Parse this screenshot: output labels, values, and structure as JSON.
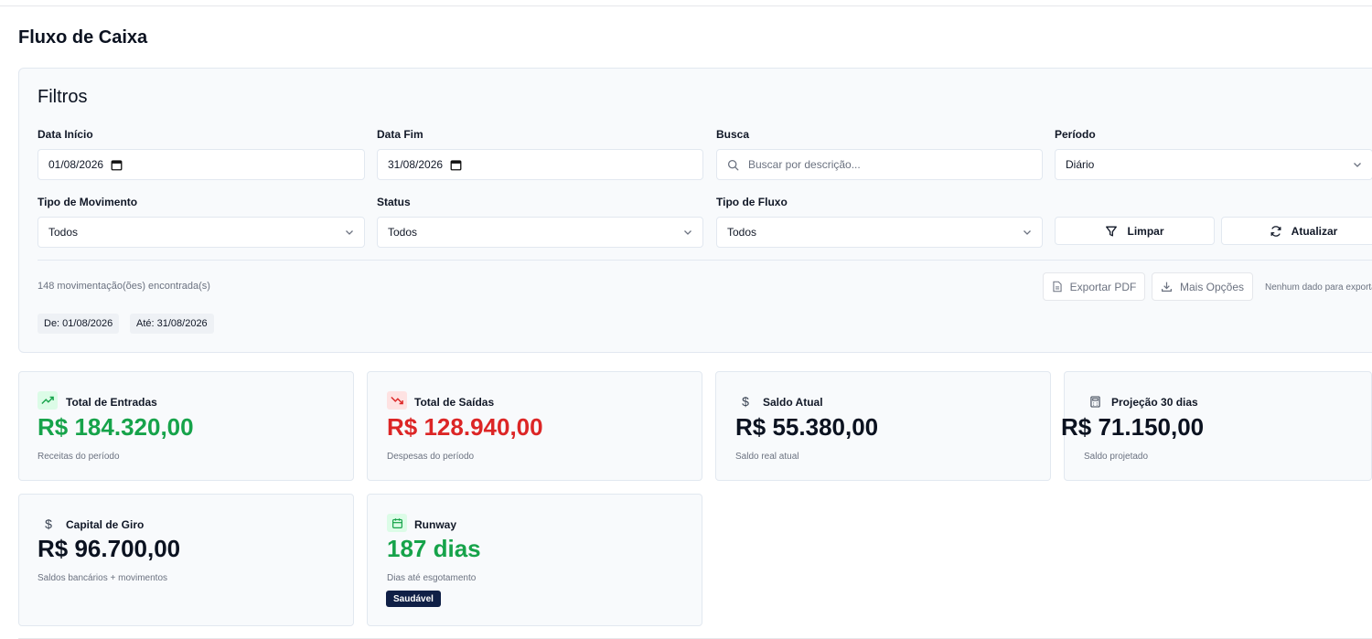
{
  "page": {
    "title": "Fluxo de Caixa"
  },
  "filters": {
    "title": "Filtros",
    "start_date": {
      "label": "Data Início",
      "value": "01/08/2026"
    },
    "end_date": {
      "label": "Data Fim",
      "value": "31/08/2026"
    },
    "search": {
      "label": "Busca",
      "placeholder": "Buscar por descrição..."
    },
    "period": {
      "label": "Período",
      "value": "Diário"
    },
    "movement_type": {
      "label": "Tipo de Movimento",
      "value": "Todos"
    },
    "status": {
      "label": "Status",
      "value": "Todos"
    },
    "flow_type": {
      "label": "Tipo de Fluxo",
      "value": "Todos"
    },
    "clear_label": "Limpar",
    "refresh_label": "Atualizar",
    "results_count": "148 movimentação(ões) encontrada(s)",
    "export_pdf_label": "Exportar PDF",
    "more_options_label": "Mais Opções",
    "no_data_text": "Nenhum dado para exportar",
    "chip_from": "De: 01/08/2026",
    "chip_to": "Até: 31/08/2026"
  },
  "kpis": {
    "entradas": {
      "label": "Total de Entradas",
      "value": "R$ 184.320,00",
      "sub": "Receitas do período",
      "icon": "trending-up-icon",
      "color": "#16a34a"
    },
    "saidas": {
      "label": "Total de Saídas",
      "value": "R$ 128.940,00",
      "sub": "Despesas do período",
      "icon": "trending-down-icon",
      "color": "#dc2626"
    },
    "saldo": {
      "label": "Saldo Atual",
      "value": "R$ 55.380,00",
      "sub": "Saldo real atual",
      "icon": "dollar-icon"
    },
    "projecao": {
      "label": "Projeção 30 dias",
      "value": "R$ 71.150,00",
      "sub": "Saldo projetado",
      "icon": "calculator-icon"
    },
    "capital": {
      "label": "Capital de Giro",
      "value": "R$ 96.700,00",
      "sub": "Saldos bancários + movimentos",
      "icon": "dollar-icon"
    },
    "runway": {
      "label": "Runway",
      "value": "187 dias",
      "sub": "Dias até esgotamento",
      "badge": "Saudável",
      "icon": "calendar-icon",
      "color": "#16a34a"
    }
  }
}
